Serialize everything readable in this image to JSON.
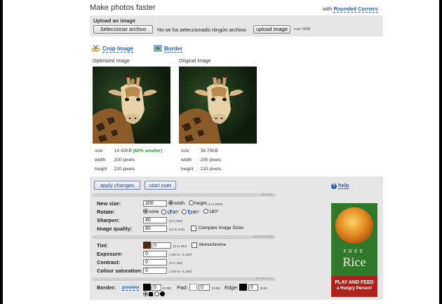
{
  "header": {
    "title": "Make photos faster",
    "with_prefix": "with",
    "with_link": "Rounded Corners"
  },
  "upload": {
    "label": "Upload an image",
    "file_button": "Seleccionar archivo",
    "no_file": "No se ha seleccionado ningún archivo",
    "upload_button": "upload image",
    "max_size": "max 5MB"
  },
  "tools": {
    "crop": "Crop Image",
    "border": "Border"
  },
  "optimized": {
    "caption": "Optimized Image",
    "size_label": "size",
    "size_value": "14.42KB",
    "size_note": "(62% smaller)",
    "width_label": "width",
    "width_value": "200 pixels",
    "height_label": "height",
    "height_value": "210 pixels"
  },
  "original": {
    "caption": "Original Image",
    "size_label": "size",
    "size_value": "38.75KB",
    "width_label": "width",
    "width_value": "200 pixels",
    "height_label": "height",
    "height_value": "210 pixels"
  },
  "actions": {
    "apply": "apply changes",
    "start_over": "start over",
    "help": "help"
  },
  "sections": {
    "basic": "BASIC",
    "advanced": "ADVANCED",
    "effects": "EFFECTS"
  },
  "basic": {
    "new_size_label": "New size:",
    "new_size_value": "200",
    "width_opt": "width",
    "height_opt": "height",
    "height_hint": "(1 to 2000)",
    "rotate_label": "Rotate:",
    "rotate_none": "none",
    "rotate_90a": "90°",
    "rotate_90b": "90°",
    "rotate_180": "180°",
    "sharpen_label": "Sharpen:",
    "sharpen_value": "40",
    "sharpen_hint": "(0 to 500)",
    "quality_label": "Image quality:",
    "quality_value": "80",
    "quality_hint": "(10 to 100)",
    "compare_label": "Compare Image Sizes"
  },
  "advanced": {
    "tint_label": "Tint:",
    "tint_value": "0",
    "tint_hint": "(0 to 100)",
    "tint_color": "#4a2a14",
    "monochrome_label": "Monochrome",
    "exposure_label": "Exposure:",
    "exposure_value": "0",
    "exposure_hint": "(-100 to +1,000)",
    "contrast_label": "Contrast:",
    "contrast_value": "0",
    "contrast_hint": "(0 to 100)",
    "saturation_label": "Colour saturation:",
    "saturation_value": "0",
    "saturation_hint": "(-100 to +1,000)"
  },
  "effects": {
    "border_label": "Border:",
    "preview_link": "preview",
    "border_value": "0",
    "border_hint": "(0-99)",
    "pad_label": "Pad:",
    "pad_value": "0",
    "pad_hint": "(0-99)",
    "edge_label": "Edge:",
    "edge_value": "0",
    "edge_hint": "(0-9)"
  },
  "ad": {
    "free": "FREE",
    "rice": "Rice",
    "play_line1": "PLAY AND FEED",
    "play_line2": "a Hungry Person!"
  },
  "colors": {
    "link": "#2a5db0",
    "panel": "#e6e6e6",
    "ad_green": "#2f7a2a",
    "ad_red": "#b0211c",
    "smaller_green": "#2a8a3a"
  }
}
